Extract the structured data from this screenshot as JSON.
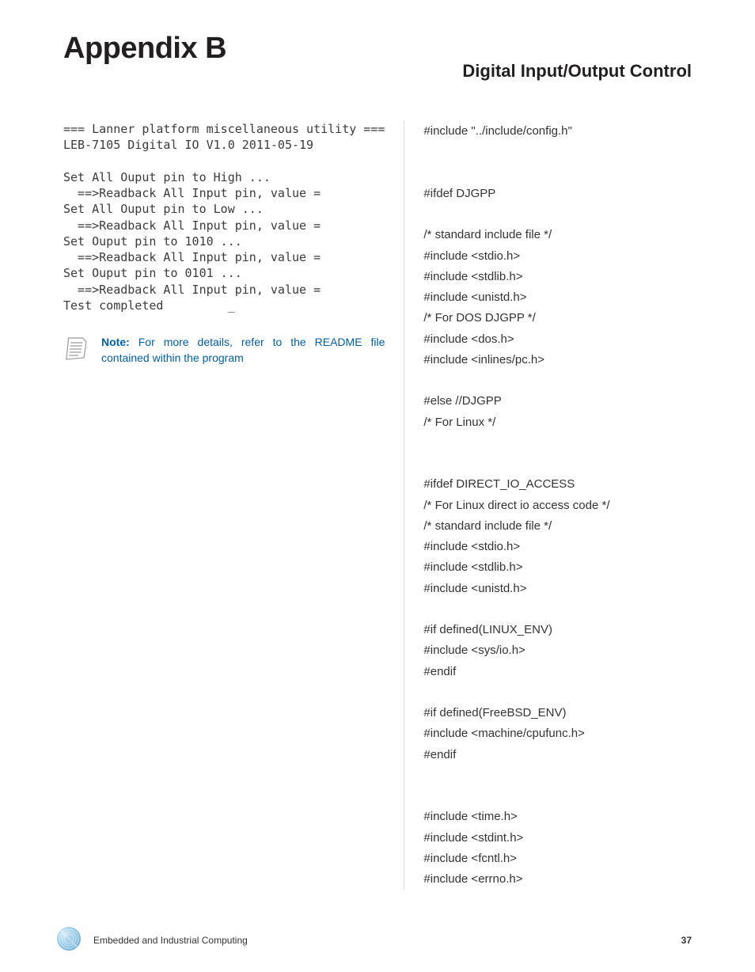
{
  "header": {
    "title": "Appendix B",
    "subtitle": "Digital Input/Output Control"
  },
  "terminal": {
    "text": "=== Lanner platform miscellaneous utility ===\nLEB-7105 Digital IO V1.0 2011-05-19\n\nSet All Ouput pin to High ...\n  ==>Readback All Input pin, value =\nSet All Ouput pin to Low ...\n  ==>Readback All Input pin, value =\nSet Ouput pin to 1010 ...\n  ==>Readback All Input pin, value =\nSet Ouput pin to 0101 ...\n  ==>Readback All Input pin, value =\nTest completed         _"
  },
  "note": {
    "label": "Note:",
    "body": " For more details, refer to the README file contained within the program"
  },
  "code": {
    "text": "#include \"../include/config.h\"\n\n\n#ifdef DJGPP\n\n/* standard include file */\n#include <stdio.h>\n#include <stdlib.h>\n#include <unistd.h>\n/* For DOS DJGPP */\n#include <dos.h>\n#include <inlines/pc.h>\n\n#else //DJGPP\n/* For Linux */\n\n\n#ifdef DIRECT_IO_ACCESS\n/* For Linux direct io access code */\n/* standard include file */\n#include <stdio.h>\n#include <stdlib.h>\n#include <unistd.h>\n\n#if defined(LINUX_ENV)\n#include <sys/io.h>\n#endif\n\n#if defined(FreeBSD_ENV)\n#include <machine/cpufunc.h>\n#endif\n\n\n#include <time.h>\n#include <stdint.h>\n#include <fcntl.h>\n#include <errno.h>"
  },
  "footer": {
    "text": "Embedded and Industrial Computing",
    "page_number": "37"
  }
}
